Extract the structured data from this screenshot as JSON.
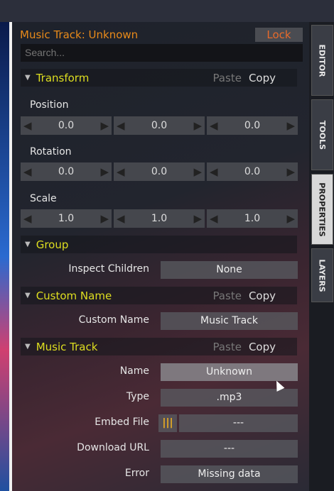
{
  "header": {
    "title": "Music Track: Unknown",
    "lock_label": "Lock"
  },
  "search": {
    "placeholder": "Search..."
  },
  "tabs": [
    "EDITOR",
    "TOOLS",
    "PROPERTIES",
    "LAYERS"
  ],
  "active_tab": "PROPERTIES",
  "actions": {
    "paste": "Paste",
    "copy": "Copy"
  },
  "transform": {
    "title": "Transform",
    "position": {
      "label": "Position",
      "values": [
        "0.0",
        "0.0",
        "0.0"
      ]
    },
    "rotation": {
      "label": "Rotation",
      "values": [
        "0.0",
        "0.0",
        "0.0"
      ]
    },
    "scale": {
      "label": "Scale",
      "values": [
        "1.0",
        "1.0",
        "1.0"
      ]
    }
  },
  "group": {
    "title": "Group",
    "inspect_children_label": "Inspect Children",
    "inspect_children_value": "None"
  },
  "custom_name": {
    "title": "Custom Name",
    "label": "Custom Name",
    "value": "Music Track"
  },
  "music_track": {
    "title": "Music Track",
    "fields": [
      {
        "label": "Name",
        "value": "Unknown"
      },
      {
        "label": "Type",
        "value": ".mp3"
      },
      {
        "label": "Embed File",
        "value": "---",
        "toggle": "|||"
      },
      {
        "label": "Download URL",
        "value": "---"
      },
      {
        "label": "Error",
        "value": "Missing data"
      }
    ]
  }
}
